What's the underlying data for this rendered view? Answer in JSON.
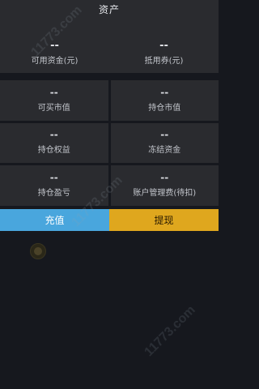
{
  "header": {
    "title": "资产"
  },
  "summary": [
    {
      "value": "--",
      "label": "可用资金(元)"
    },
    {
      "value": "--",
      "label": "抵用券(元)"
    }
  ],
  "details": [
    {
      "value": "--",
      "label": "可买市值"
    },
    {
      "value": "--",
      "label": "持仓市值"
    },
    {
      "value": "--",
      "label": "持仓权益"
    },
    {
      "value": "--",
      "label": "冻结资金"
    },
    {
      "value": "--",
      "label": "持仓盈亏"
    },
    {
      "value": "--",
      "label": "账户管理费(待扣)"
    }
  ],
  "actions": {
    "deposit_label": "充值",
    "withdraw_label": "提现"
  },
  "watermark": {
    "text": "11773.com"
  },
  "colors": {
    "background": "#16181e",
    "panel": "#2a2b2f",
    "deposit": "#49a6dd",
    "withdraw": "#dfa71e"
  }
}
